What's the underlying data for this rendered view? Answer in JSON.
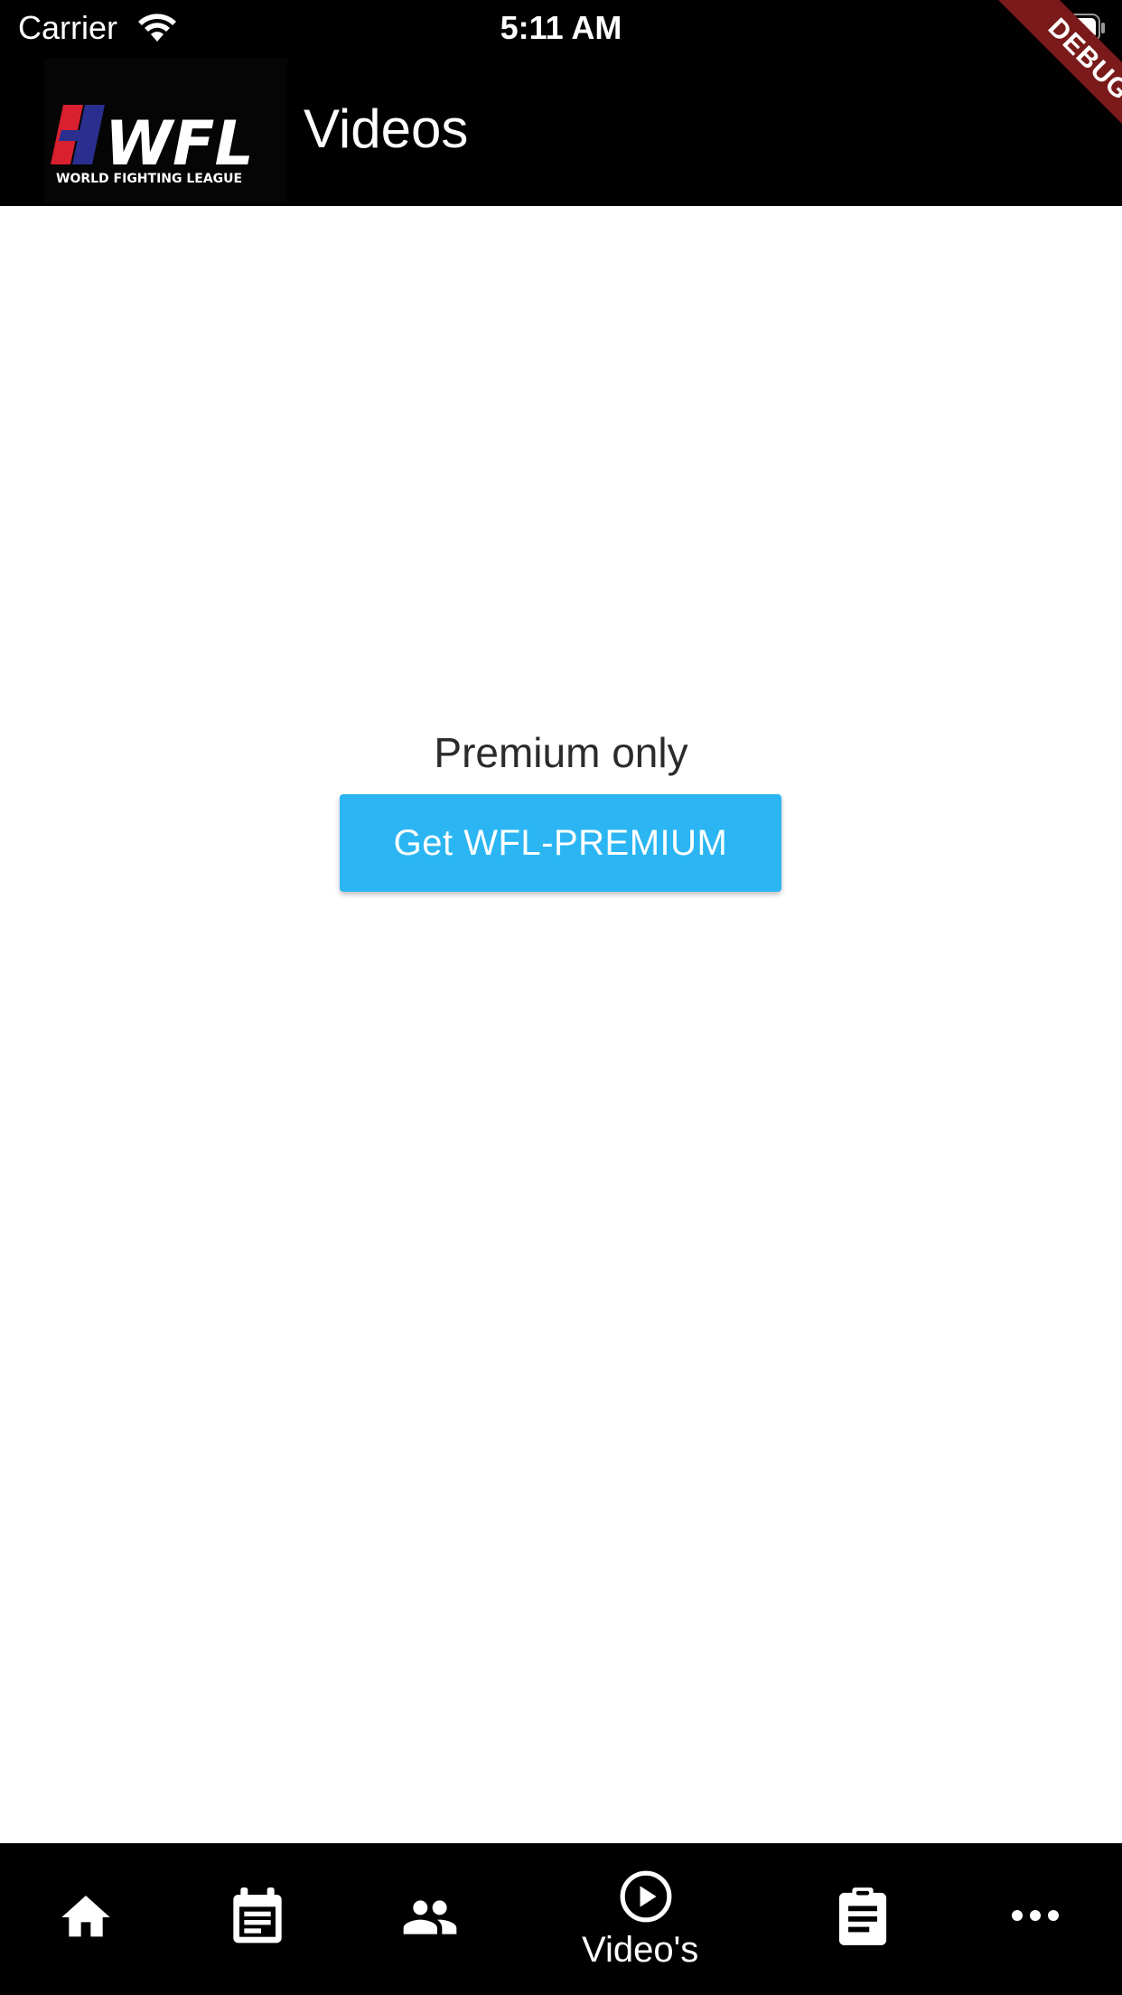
{
  "status_bar": {
    "carrier": "Carrier",
    "time": "5:11 AM"
  },
  "app_bar": {
    "logo_text": "WFL",
    "logo_subtitle": "WORLD FIGHTING LEAGUE",
    "title": "Videos",
    "debug_banner": "DEBUG"
  },
  "main": {
    "message": "Premium only",
    "button_label": "Get WFL-PREMIUM"
  },
  "bottom_nav": {
    "items": [
      {
        "icon": "home-icon"
      },
      {
        "icon": "calendar-icon"
      },
      {
        "icon": "people-icon"
      },
      {
        "icon": "play-circle-icon",
        "label": "Video's",
        "selected": true
      },
      {
        "icon": "clipboard-icon"
      },
      {
        "icon": "more-horizontal-icon"
      }
    ]
  },
  "colors": {
    "accent": "#2bb6f3",
    "bar_background": "#000000",
    "debug_ribbon": "#7a1a1a",
    "logo_red": "#d8202f",
    "logo_blue": "#2a2f8f"
  }
}
